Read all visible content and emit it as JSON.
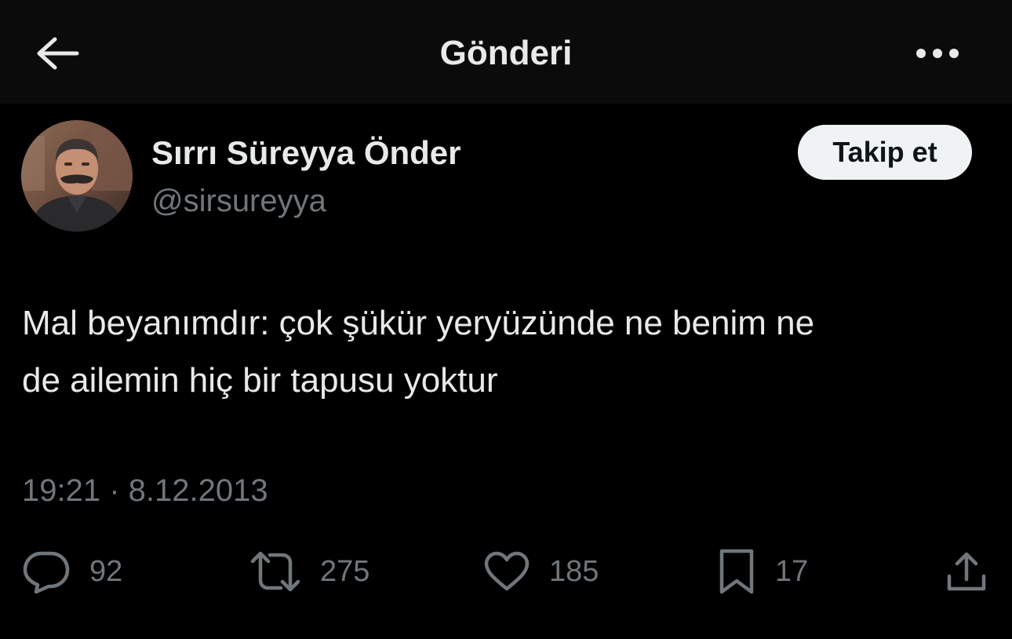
{
  "header": {
    "title": "Gönderi",
    "back_icon": "arrow-left-icon",
    "more_icon": "more-dots-icon"
  },
  "author": {
    "name": "Sırrı Süreyya Önder",
    "handle": "@sirsureyya",
    "follow_label": "Takip et"
  },
  "tweet": {
    "lines": [
      "Mal beyanımdır: çok şükür yeryüzünde ne benim ne",
      "de ailemin hiç bir tapusu yoktur"
    ],
    "timestamp": "19:21 · 8.12.2013"
  },
  "actions": {
    "replies": "92",
    "retweets": "275",
    "likes": "185",
    "bookmarks": "17"
  },
  "colors": {
    "background": "#000000",
    "header_background": "#0b0b0b",
    "text": "#e7e9ea",
    "secondary": "#71767b",
    "follow_button": "#eff3f4"
  }
}
